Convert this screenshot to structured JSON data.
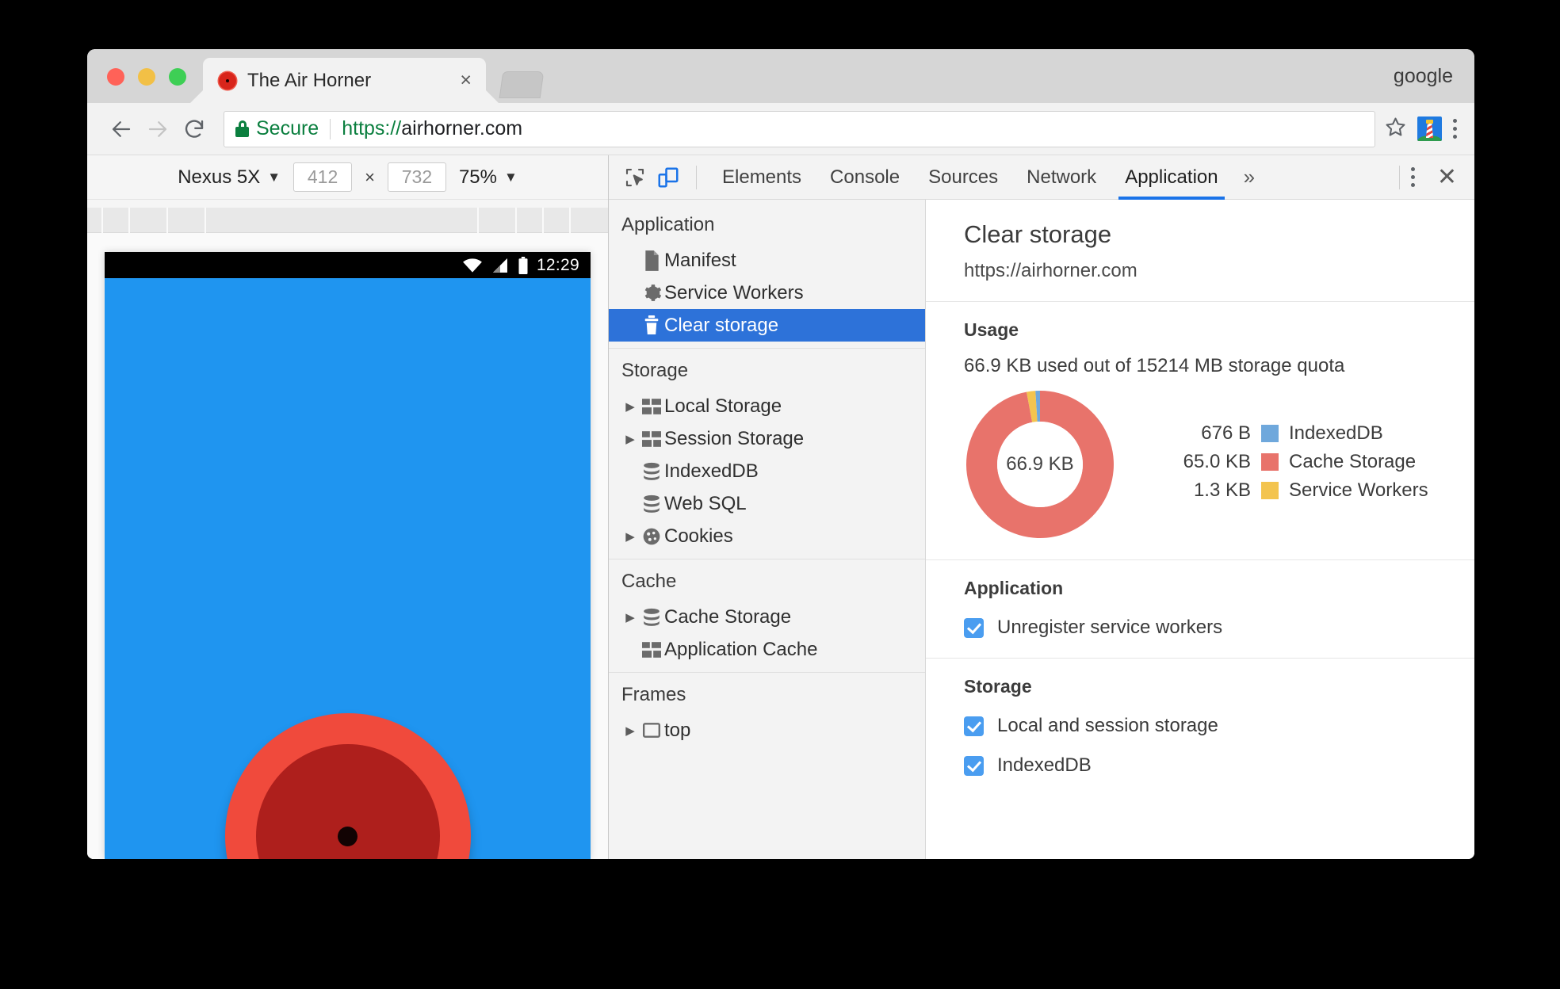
{
  "browser": {
    "profile_label": "google",
    "tab": {
      "title": "The Air Horner",
      "close_label": "×",
      "favicon": "air-horn-favicon"
    },
    "new_tab_label": "+",
    "omnibox": {
      "secure_label": "Secure",
      "url_scheme": "https://",
      "url_host": "airhorner.com",
      "url_full": "https://airhorner.com"
    },
    "nav": {
      "back": "←",
      "forward": "→",
      "reload": "↻"
    }
  },
  "device_toolbar": {
    "device": "Nexus 5X",
    "width": "412",
    "height": "732",
    "multiply": "×",
    "zoom": "75%",
    "caret": "▼"
  },
  "phone": {
    "status_bar": {
      "time": "12:29",
      "wifi_icon": "wifi-icon",
      "signal_icon": "cell-signal-icon",
      "battery_icon": "battery-icon"
    },
    "horn_button_name": "air-horn-button"
  },
  "devtools": {
    "icons": {
      "inspect": "inspect-element-icon",
      "device": "device-toolbar-icon"
    },
    "tabs": [
      {
        "label": "Elements",
        "active": false
      },
      {
        "label": "Console",
        "active": false
      },
      {
        "label": "Sources",
        "active": false
      },
      {
        "label": "Network",
        "active": false
      },
      {
        "label": "Application",
        "active": true
      }
    ],
    "more_tabs": "»",
    "close_label": "✕",
    "sidebar": [
      {
        "header": "Application",
        "items": [
          {
            "label": "Manifest",
            "icon": "document-icon",
            "arrow": false,
            "selected": false
          },
          {
            "label": "Service Workers",
            "icon": "gear-icon",
            "arrow": false,
            "selected": false
          },
          {
            "label": "Clear storage",
            "icon": "trash-icon",
            "arrow": false,
            "selected": true
          }
        ]
      },
      {
        "header": "Storage",
        "items": [
          {
            "label": "Local Storage",
            "icon": "table-icon",
            "arrow": true,
            "selected": false
          },
          {
            "label": "Session Storage",
            "icon": "table-icon",
            "arrow": true,
            "selected": false
          },
          {
            "label": "IndexedDB",
            "icon": "database-icon",
            "arrow": false,
            "selected": false
          },
          {
            "label": "Web SQL",
            "icon": "database-icon",
            "arrow": false,
            "selected": false
          },
          {
            "label": "Cookies",
            "icon": "cookie-icon",
            "arrow": true,
            "selected": false
          }
        ]
      },
      {
        "header": "Cache",
        "items": [
          {
            "label": "Cache Storage",
            "icon": "database-icon",
            "arrow": true,
            "selected": false
          },
          {
            "label": "Application Cache",
            "icon": "table-icon",
            "arrow": false,
            "selected": false
          }
        ]
      },
      {
        "header": "Frames",
        "items": [
          {
            "label": "top",
            "icon": "frame-icon",
            "arrow": true,
            "selected": false
          }
        ]
      }
    ],
    "panel": {
      "title": "Clear storage",
      "origin": "https://airhorner.com",
      "usage": {
        "section_title": "Usage",
        "summary": "66.9 KB used out of 15214 MB storage quota",
        "center_label": "66.9 KB"
      },
      "application": {
        "section_title": "Application",
        "checkboxes": [
          {
            "label": "Unregister service workers",
            "checked": true
          }
        ]
      },
      "storage": {
        "section_title": "Storage",
        "checkboxes": [
          {
            "label": "Local and session storage",
            "checked": true
          },
          {
            "label": "IndexedDB",
            "checked": true
          }
        ]
      }
    }
  },
  "chart_data": {
    "type": "pie",
    "title": "Usage",
    "center_label": "66.9 KB",
    "total_label": "66.9 KB used out of 15214 MB storage quota",
    "legend_position": "right",
    "categories": [
      "IndexedDB",
      "Cache Storage",
      "Service Workers"
    ],
    "value_labels": [
      "676 B",
      "65.0 KB",
      "1.3 KB"
    ],
    "values_bytes": [
      676,
      66560,
      1331
    ],
    "percentages": [
      1.0,
      97.0,
      2.0
    ],
    "colors": [
      "#6fa8dc",
      "#e8736b",
      "#f3c44f"
    ],
    "donut": true
  },
  "colors": {
    "accent_blue": "#1a73e8",
    "selection_blue": "#2d72d9",
    "secure_green": "#0b7f3f",
    "cache_red": "#e8736b",
    "sw_yellow": "#f3c44f",
    "idb_blue": "#6fa8dc",
    "phone_bg": "#1f95f0",
    "horn_outer": "#f04a3c",
    "horn_inner": "#ae1f1c",
    "checkbox_blue": "#4a9df0"
  }
}
